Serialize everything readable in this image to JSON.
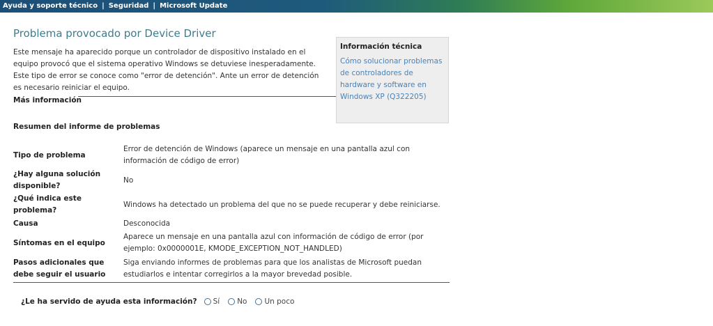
{
  "nav": {
    "items": [
      {
        "label": "Ayuda y soporte técnico"
      },
      {
        "label": "Seguridad"
      },
      {
        "label": "Microsoft Update"
      }
    ],
    "separator": "|"
  },
  "main": {
    "title": "Problema provocado por Device Driver",
    "intro": "Este mensaje ha aparecido porque un controlador de dispositivo instalado en el equipo provocó que el sistema operativo Windows se detuviese inesperadamente. Este tipo de error se conoce como \"error de detención\". Ante un error de detención es necesario reiniciar el equipo.",
    "more_info": "Más información",
    "summary_heading": "Resumen del informe de problemas"
  },
  "tech_info": {
    "heading": "Información técnica",
    "link": "Cómo solucionar problemas de controladores de hardware y software en Windows XP (Q322205)"
  },
  "summary": {
    "rows": [
      {
        "key": "Tipo de problema",
        "value": "Error de detención de Windows (aparece un mensaje en una pantalla azul con información de código de error)"
      },
      {
        "key": "¿Hay alguna solución disponible?",
        "value": "No"
      },
      {
        "key": "¿Qué indica este problema?",
        "value": "Windows ha detectado un problema del que no se puede recuperar y debe reiniciarse."
      },
      {
        "key": "Causa",
        "value": "Desconocida"
      },
      {
        "key": "Síntomas en el equipo",
        "value": "Aparece un mensaje en una pantalla azul con información de código de error (por ejemplo: 0x0000001E, KMODE_EXCEPTION_NOT_HANDLED)"
      },
      {
        "key": "Pasos adicionales que debe seguir el usuario",
        "value": "Siga enviando informes de problemas para que los analistas de Microsoft puedan estudiarlos e intentar corregirlos a la mayor brevedad posible."
      }
    ]
  },
  "feedback": {
    "question": "¿Le ha servido de ayuda esta información?",
    "options": [
      {
        "label": "Sí"
      },
      {
        "label": "No"
      },
      {
        "label": "Un poco"
      }
    ]
  }
}
